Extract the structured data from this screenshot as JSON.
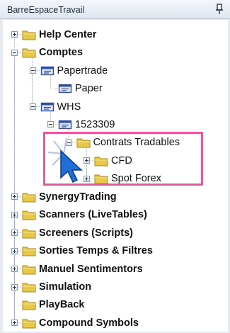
{
  "panel": {
    "title": "BarreEspaceTravail",
    "pin_icon": "pin-icon"
  },
  "tree": [
    {
      "label": "Help Center",
      "bold": true,
      "icon": "folder-icon",
      "expander": "plus",
      "level": 0
    },
    {
      "label": "Comptes",
      "bold": true,
      "icon": "folder-icon",
      "expander": "minus",
      "level": 0
    },
    {
      "label": "Papertrade",
      "bold": false,
      "icon": "account-icon",
      "expander": "minus",
      "level": 1
    },
    {
      "label": "Paper",
      "bold": false,
      "icon": "account-icon",
      "expander": "none",
      "level": 2
    },
    {
      "label": "WHS",
      "bold": false,
      "icon": "account-icon",
      "expander": "minus",
      "level": 1
    },
    {
      "label": "1523309",
      "bold": false,
      "icon": "account-icon",
      "expander": "minus",
      "level": 2
    },
    {
      "label": "Contrats Tradables",
      "bold": false,
      "icon": "folder-icon",
      "expander": "minus",
      "level": 3
    },
    {
      "label": "CFD",
      "bold": false,
      "icon": "folder-icon",
      "expander": "plus",
      "level": 4
    },
    {
      "label": "Spot Forex",
      "bold": false,
      "icon": "folder-icon",
      "expander": "plus",
      "level": 4
    },
    {
      "label": "SynergyTrading",
      "bold": true,
      "icon": "folder-icon",
      "expander": "plus",
      "level": 0
    },
    {
      "label": "Scanners (LiveTables)",
      "bold": true,
      "icon": "folder-icon",
      "expander": "plus",
      "level": 0
    },
    {
      "label": "Screeners (Scripts)",
      "bold": true,
      "icon": "folder-icon",
      "expander": "plus",
      "level": 0
    },
    {
      "label": "Sorties Temps & Filtres",
      "bold": true,
      "icon": "folder-icon",
      "expander": "plus",
      "level": 0
    },
    {
      "label": "Manuel Sentimentors",
      "bold": true,
      "icon": "folder-icon",
      "expander": "plus",
      "level": 0
    },
    {
      "label": "Simulation",
      "bold": true,
      "icon": "folder-icon",
      "expander": "plus",
      "level": 0
    },
    {
      "label": "PlayBack",
      "bold": true,
      "icon": "folder-icon",
      "expander": "none",
      "level": 0
    },
    {
      "label": "Compound Symbols",
      "bold": true,
      "icon": "folder-icon",
      "expander": "plus",
      "level": 0
    }
  ],
  "colors": {
    "highlight": "#e9579f",
    "folder": "#e8c84a",
    "account": "#2f4f9e",
    "cursor": "#1f6fd6"
  }
}
